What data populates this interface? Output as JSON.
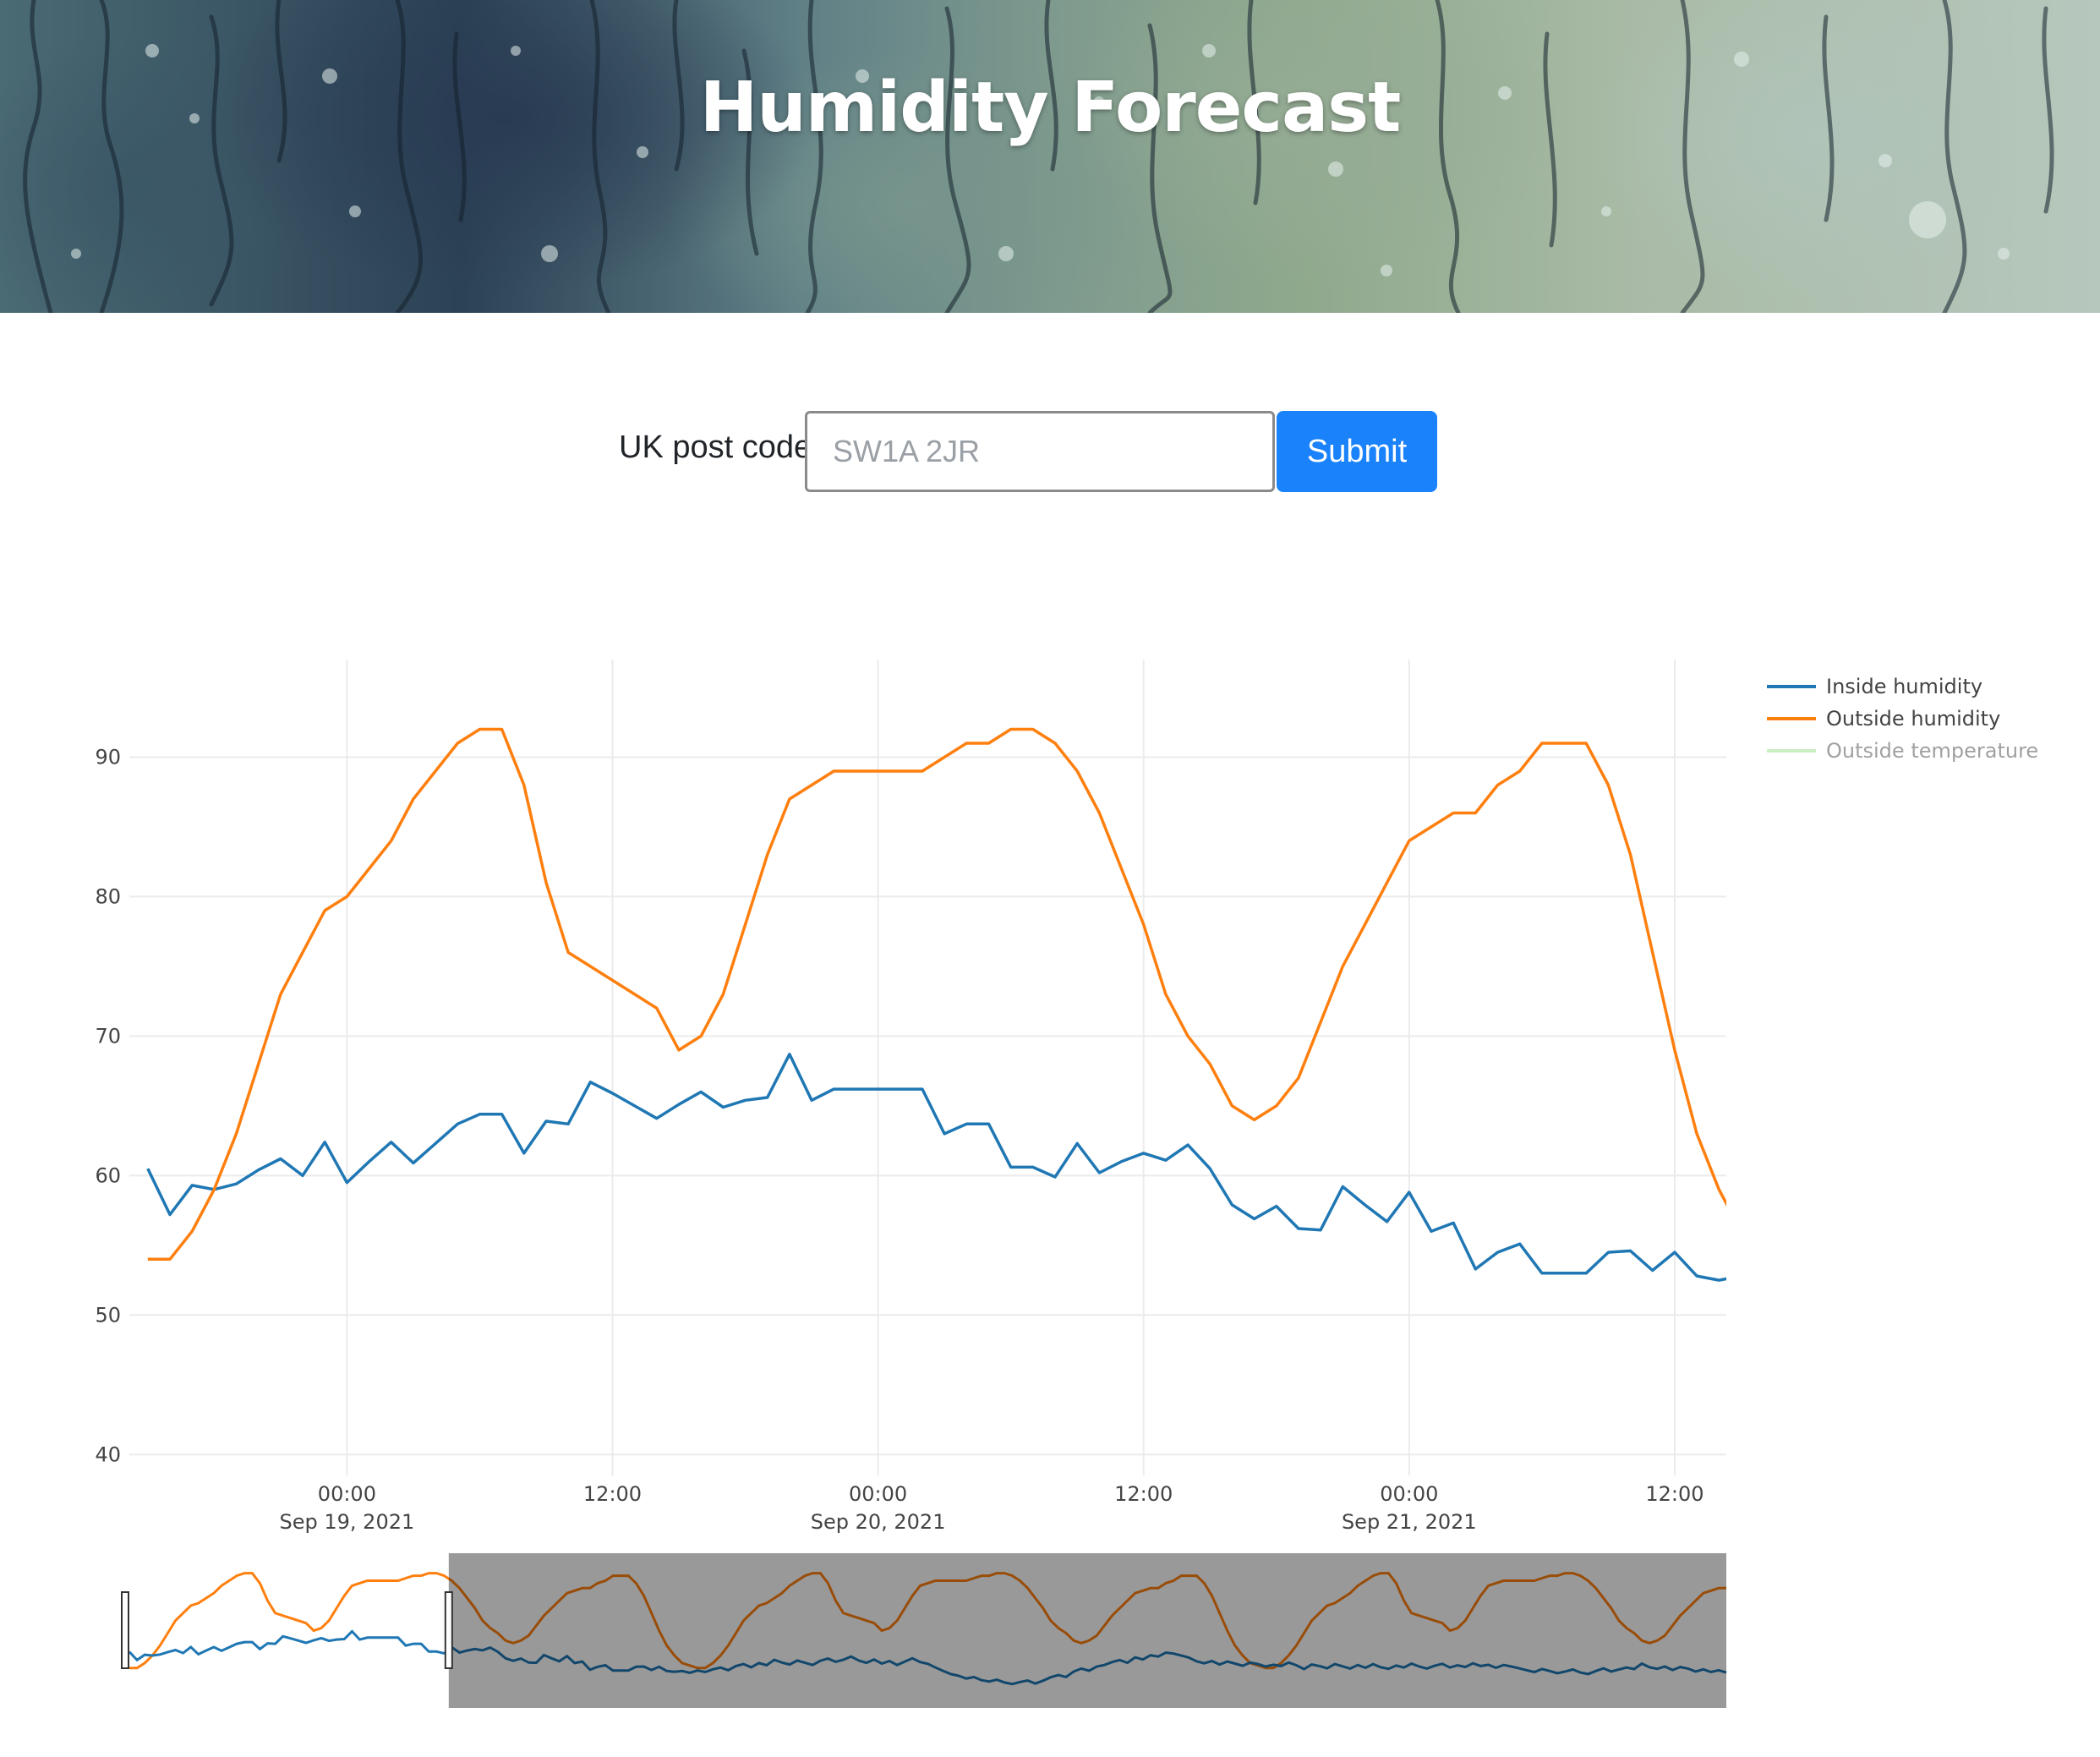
{
  "header": {
    "title": "Humidity Forecast"
  },
  "form": {
    "label": "UK post code",
    "input_value": "",
    "placeholder": "SW1A 2JR",
    "submit_label": "Submit"
  },
  "chart_data": {
    "type": "line",
    "title": "",
    "xlabel": "",
    "ylabel": "",
    "ylim": [
      38.5,
      97
    ],
    "yticks": [
      40,
      50,
      60,
      70,
      80,
      90
    ],
    "x_start": "2021-09-18T15:00",
    "x_step_hours": 1,
    "xlim": [
      "2021-09-18T14:10",
      "2021-09-21T14:20"
    ],
    "xticks": [
      {
        "time": "2021-09-19T00:00",
        "label": "00:00",
        "sublabel": "Sep 19, 2021"
      },
      {
        "time": "2021-09-19T12:00",
        "label": "12:00",
        "sublabel": ""
      },
      {
        "time": "2021-09-20T00:00",
        "label": "00:00",
        "sublabel": "Sep 20, 2021"
      },
      {
        "time": "2021-09-20T12:00",
        "label": "12:00",
        "sublabel": ""
      },
      {
        "time": "2021-09-21T00:00",
        "label": "00:00",
        "sublabel": "Sep 21, 2021"
      },
      {
        "time": "2021-09-21T12:00",
        "label": "12:00",
        "sublabel": ""
      }
    ],
    "grid": true,
    "legend_position": "top-right",
    "series": [
      {
        "name": "Inside humidity",
        "color": "#1f77b4",
        "visible": true,
        "values": [
          60.5,
          57.2,
          59.3,
          59.0,
          59.4,
          60.4,
          61.2,
          60.0,
          62.4,
          59.5,
          61.0,
          62.4,
          60.9,
          62.3,
          63.7,
          64.4,
          64.4,
          61.6,
          63.9,
          63.7,
          66.7,
          65.9,
          65.0,
          64.1,
          65.1,
          66.0,
          64.9,
          65.4,
          65.6,
          68.7,
          65.4,
          66.2,
          66.2,
          66.2,
          66.2,
          66.2,
          63.0,
          63.7,
          63.7,
          60.6,
          60.6,
          59.9,
          62.3,
          60.2,
          61.0,
          61.6,
          61.1,
          62.2,
          60.5,
          57.9,
          56.9,
          57.8,
          56.2,
          56.1,
          59.2,
          57.9,
          56.7,
          58.8,
          56.0,
          56.6,
          53.3,
          54.5,
          55.1,
          53.0,
          53.0,
          53.0,
          54.5,
          54.6,
          53.2,
          54.5,
          52.8,
          52.5,
          52.8,
          52.1
        ]
      },
      {
        "name": "Outside humidity",
        "color": "#ff7f0e",
        "visible": true,
        "values": [
          54,
          54,
          56,
          59,
          63,
          68,
          73,
          76,
          79,
          80,
          82,
          84,
          87,
          89,
          91,
          92,
          92,
          88,
          81,
          76,
          75,
          74,
          73,
          72,
          69,
          70,
          73,
          78,
          83,
          87,
          88,
          89,
          89,
          89,
          89,
          89,
          90,
          91,
          91,
          92,
          92,
          91,
          89,
          86,
          82,
          78,
          73,
          70,
          68,
          65,
          64,
          65,
          67,
          71,
          75,
          78,
          81,
          84,
          85,
          86,
          86,
          88,
          89,
          91,
          91,
          91,
          88,
          83,
          76,
          69,
          63,
          59,
          56,
          55
        ]
      },
      {
        "name": "Outside temperature",
        "color": "#98df8a",
        "visible": false,
        "values": []
      }
    ]
  },
  "rangeslider": {
    "selected_fraction": [
      0,
      0.2
    ],
    "inside_values": [
      60.5,
      57.2,
      59.3,
      59.0,
      59.4,
      60.4,
      61.2,
      60.0,
      62.4,
      59.5,
      61.0,
      62.4,
      60.9,
      62.3,
      63.7,
      64.4,
      64.4,
      61.6,
      63.9,
      63.7,
      66.7,
      65.9,
      65.0,
      64.1,
      65.1,
      66.0,
      64.9,
      65.4,
      65.6,
      68.7,
      65.4,
      66.2,
      66.2,
      66.2,
      66.2,
      66.2,
      63.0,
      63.7,
      63.7,
      60.6,
      60.6,
      59.9,
      62.3,
      60.2,
      61.0,
      61.6,
      61.1,
      62.2,
      60.5,
      57.9,
      56.9,
      57.8,
      56.2,
      56.1,
      59.2,
      57.9,
      56.7,
      58.8,
      56.0,
      56.6,
      53.3,
      54.5,
      55.1,
      53.0,
      53.0,
      53.0,
      54.5,
      54.6,
      53.2,
      54.5,
      52.8,
      52.5,
      52.8,
      52.1,
      53.0,
      52.4,
      53.5,
      54.2,
      53.1,
      54.8,
      55.6,
      54.3,
      56.0,
      55.1,
      57.3,
      56.2,
      55.4,
      57.0,
      56.1,
      55.2,
      56.9,
      57.8,
      56.5,
      57.3,
      58.6,
      57.0,
      56.1,
      57.4,
      55.8,
      56.8,
      55.2,
      56.6,
      57.9,
      56.4,
      55.7,
      54.2,
      52.8,
      51.6,
      50.9,
      49.8,
      50.4,
      49.1,
      48.6,
      49.3,
      48.2,
      47.6,
      48.4,
      49.0,
      47.8,
      48.9,
      50.3,
      51.2,
      50.4,
      52.6,
      53.8,
      52.9,
      54.6,
      55.2,
      56.4,
      57.2,
      56.1,
      58.3,
      57.4,
      59.1,
      58.6,
      60.2,
      59.8,
      59.0,
      58.2,
      56.7,
      55.9,
      56.8,
      55.4,
      56.6,
      55.8,
      54.9,
      56.2,
      55.6,
      54.6,
      55.3,
      54.8,
      56.2,
      55.1,
      53.6,
      55.4,
      54.8,
      53.9,
      55.6,
      54.7,
      53.8,
      55.2,
      54.1,
      55.6,
      54.3,
      53.7,
      55.0,
      54.2,
      55.8,
      54.6,
      53.8,
      54.9,
      55.7,
      54.2,
      55.1,
      54.4,
      55.9,
      54.8,
      55.3,
      54.1,
      55.2,
      54.6,
      53.9,
      53.1,
      52.4,
      53.6,
      52.8,
      51.9,
      52.6,
      53.4,
      52.2,
      51.6,
      52.8,
      53.9,
      52.6,
      53.4,
      54.2,
      53.6,
      55.8,
      54.3,
      53.7,
      54.6,
      53.2,
      54.4,
      53.8,
      52.6,
      53.5,
      52.4,
      53.1,
      52.2
    ]
  }
}
